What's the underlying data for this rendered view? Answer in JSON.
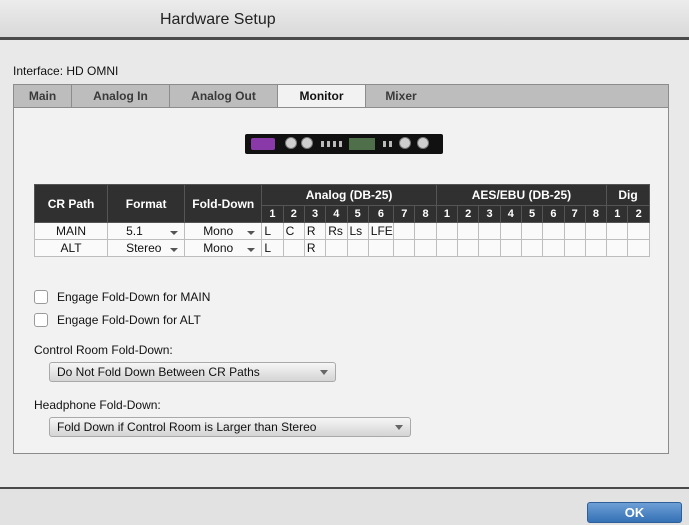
{
  "window": {
    "title": "Hardware Setup"
  },
  "interface": {
    "label": "Interface: HD OMNI"
  },
  "tabs": [
    {
      "label": "Main"
    },
    {
      "label": "Analog In"
    },
    {
      "label": "Analog Out"
    },
    {
      "label": "Monitor",
      "active": true
    },
    {
      "label": "Mixer"
    }
  ],
  "table": {
    "headers": {
      "cr_path": "CR Path",
      "format": "Format",
      "fold_down": "Fold-Down",
      "analog": "Analog (DB-25)",
      "aes": "AES/EBU (DB-25)",
      "dig": "Dig"
    },
    "analog_nums": [
      "1",
      "2",
      "3",
      "4",
      "5",
      "6",
      "7",
      "8"
    ],
    "aes_nums": [
      "1",
      "2",
      "3",
      "4",
      "5",
      "6",
      "7",
      "8"
    ],
    "dig_nums": [
      "1",
      "2"
    ],
    "rows": [
      {
        "path": "MAIN",
        "format": "5.1",
        "fold": "Mono",
        "channels": [
          "L",
          "C",
          "R",
          "Rs",
          "Ls",
          "LFE",
          "",
          "",
          "",
          "",
          "",
          "",
          "",
          "",
          "",
          "",
          "",
          ""
        ]
      },
      {
        "path": "ALT",
        "format": "Stereo",
        "fold": "Mono",
        "channels": [
          "L",
          "",
          "R",
          "",
          "",
          "",
          "",
          "",
          "",
          "",
          "",
          "",
          "",
          "",
          "",
          "",
          "",
          ""
        ]
      }
    ]
  },
  "options": {
    "engage_main": {
      "label": "Engage Fold-Down for MAIN",
      "checked": false
    },
    "engage_alt": {
      "label": "Engage Fold-Down for ALT",
      "checked": false
    }
  },
  "control_room": {
    "label": "Control Room Fold-Down:",
    "value": "Do Not Fold Down Between CR Paths"
  },
  "headphone": {
    "label": "Headphone Fold-Down:",
    "value": "Fold Down if Control Room is Larger than Stereo"
  },
  "footer": {
    "ok_label": "OK"
  },
  "colors": {
    "accent": "#3f7bc0",
    "header_bg": "#303030"
  }
}
